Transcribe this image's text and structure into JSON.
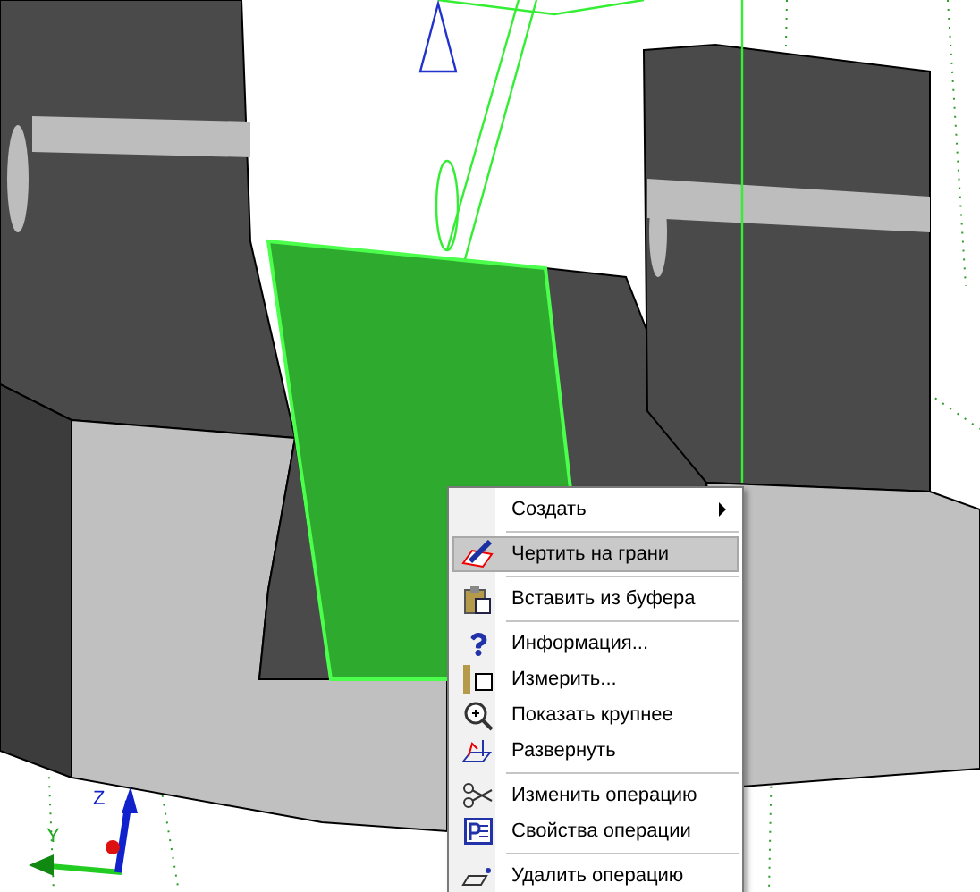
{
  "axes": {
    "y_label": "Y",
    "z_label": "Z"
  },
  "context_menu": {
    "items": [
      {
        "kind": "item",
        "label": "Создать",
        "has_submenu": true,
        "selected": false
      },
      {
        "kind": "separator"
      },
      {
        "kind": "item",
        "label": "Чертить на грани",
        "has_submenu": false,
        "selected": true
      },
      {
        "kind": "separator"
      },
      {
        "kind": "item",
        "label": "Вставить из буфера",
        "has_submenu": false,
        "selected": false
      },
      {
        "kind": "separator"
      },
      {
        "kind": "item",
        "label": "Информация...",
        "has_submenu": false,
        "selected": false
      },
      {
        "kind": "item",
        "label": "Измерить...",
        "has_submenu": false,
        "selected": false
      },
      {
        "kind": "item",
        "label": "Показать крупнее",
        "has_submenu": false,
        "selected": false
      },
      {
        "kind": "item",
        "label": "Развернуть",
        "has_submenu": false,
        "selected": false
      },
      {
        "kind": "separator"
      },
      {
        "kind": "item",
        "label": "Изменить операцию",
        "has_submenu": false,
        "selected": false
      },
      {
        "kind": "item",
        "label": "Свойства операции",
        "has_submenu": false,
        "selected": false
      },
      {
        "kind": "separator"
      },
      {
        "kind": "item",
        "label": "Удалить операцию",
        "has_submenu": false,
        "selected": false
      }
    ]
  }
}
